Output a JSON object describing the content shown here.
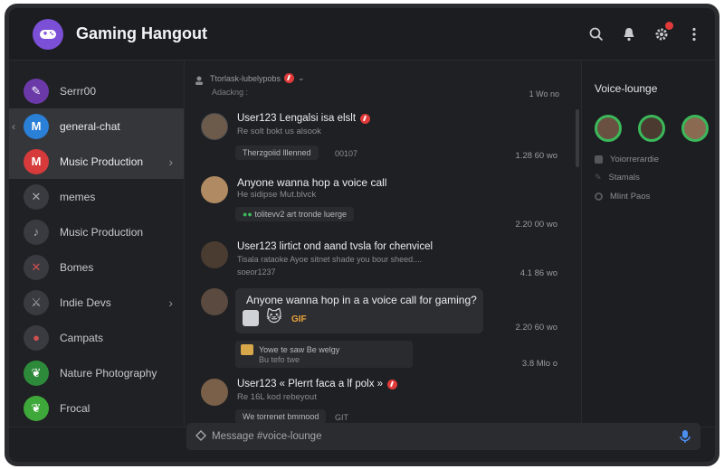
{
  "app": {
    "title": "Gaming Hangout"
  },
  "sidebar": {
    "items": [
      {
        "label": "Serrr00",
        "icon": "brush-icon",
        "color": "#6b3aa8"
      },
      {
        "label": "general-chat",
        "icon": "M",
        "color": "#2a7fd6",
        "active": true
      },
      {
        "label": "Music Production",
        "icon": "M",
        "color": "#d63a3a",
        "active": true
      },
      {
        "label": "memes",
        "icon": "cross-icon",
        "color": "#3a3b40"
      },
      {
        "label": "Music Production",
        "icon": "mic-icon",
        "color": "#3a3b40"
      },
      {
        "label": "Bomes",
        "icon": "x-icon",
        "color": "#3a3b40"
      },
      {
        "label": "Indie Devs",
        "icon": "sword-icon",
        "color": "#3a3b40"
      },
      {
        "label": "Campats",
        "icon": "flame-icon",
        "color": "#3a3b40"
      },
      {
        "label": "Nature Photography",
        "icon": "leaf-icon",
        "color": "#2d8a3a"
      },
      {
        "label": "Frocal",
        "icon": "leaf-icon",
        "color": "#3fa83a"
      }
    ]
  },
  "chat": {
    "header": {
      "line1": "Ttorlask-lubelypobs",
      "line2": "Adackng :",
      "right": "1 Wo no"
    },
    "messages": [
      {
        "user": "User123 Lengalsi isa elslt",
        "sub": "Re solt bokt us alsook",
        "pill": "Therzgoiid lllenned",
        "pill_extra": "00107",
        "time": "1.28 60 wo"
      },
      {
        "user": "Anyone wanna hop a voice call",
        "sub": "He sidipse Mut.blvck",
        "pill": "tolitevv2 art tronde luerge",
        "time": "2.20 00 wo"
      },
      {
        "user": "User123 lirtict ond aand tvsla for chenvicel",
        "sub": "Tisala rataoke Ayoe sitnet shade you bour sheed....",
        "sub2": "soeor1237",
        "time": "4.1 86 wo"
      },
      {
        "bubble_text": "Anyone wanna hop in a a voice call for gaming?",
        "gif": "GIF",
        "time": "2.20 60 wo"
      },
      {
        "pill": "Yowe te saw Be welgy",
        "pill2": "Bu tefo twe",
        "time": "3.8 Mlo o"
      },
      {
        "user": "User123 « Plerrt faca a lf polx »",
        "sub": "Re 16L kod rebeyout",
        "pill": "We torrenet bmmood",
        "pill_extra": "GIT"
      }
    ]
  },
  "right_panel": {
    "title": "Voice-lounge",
    "items": [
      "Yoiorrerardie",
      "Stamals",
      "Mlint Paos"
    ]
  },
  "composer": {
    "placeholder": "Message #voice-lounge"
  }
}
